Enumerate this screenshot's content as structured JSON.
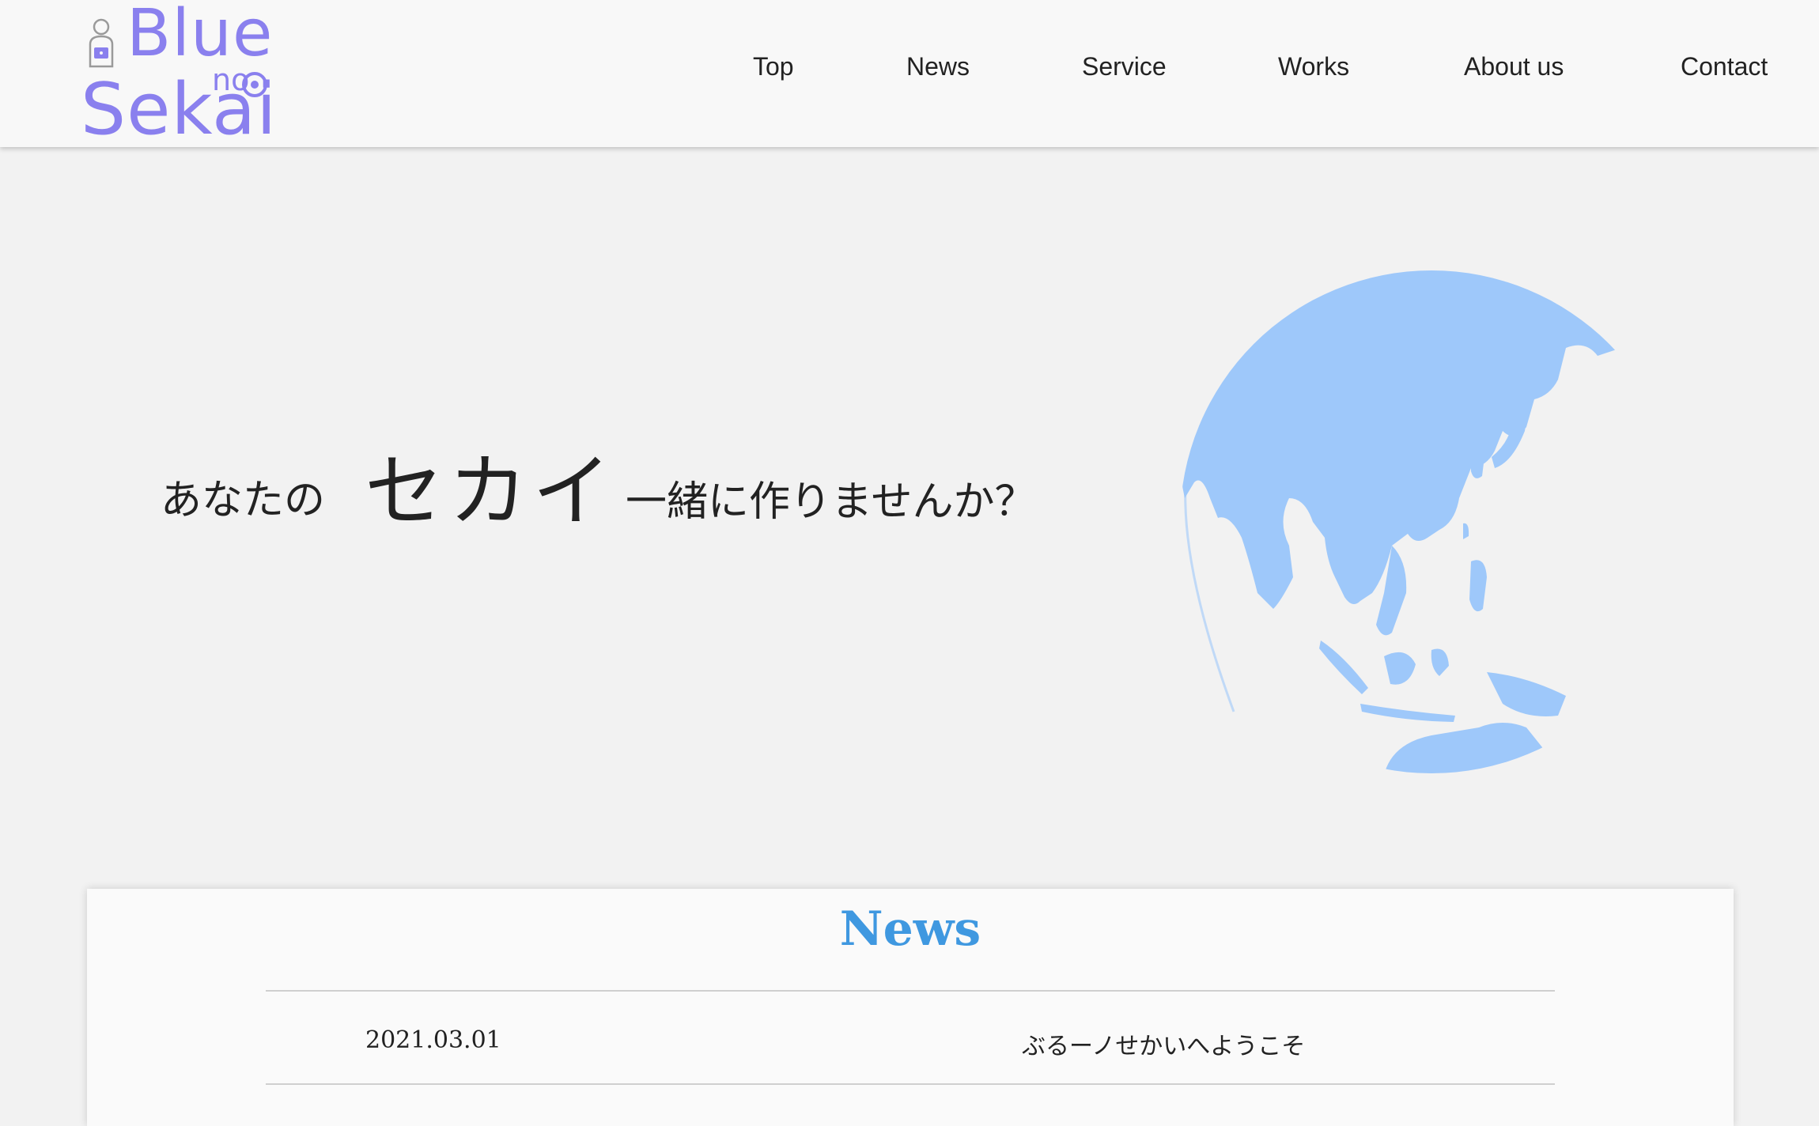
{
  "logo": {
    "line1": "Blue",
    "line2": "no",
    "line3": "Sekai"
  },
  "nav": [
    {
      "label": "Top"
    },
    {
      "label": "News"
    },
    {
      "label": "Service"
    },
    {
      "label": "Works"
    },
    {
      "label": "About us"
    },
    {
      "label": "Contact"
    }
  ],
  "hero": {
    "pre": "あなたの",
    "highlight": "セカイ",
    "post": "一緒に作りませんか？"
  },
  "news": {
    "title": "News",
    "items": [
      {
        "date": "2021.03.01",
        "text": "ぶるーノせかいへようこそ"
      }
    ]
  },
  "colors": {
    "logo": "#8a80ee",
    "accent": "#3f98e0",
    "globe": "#9ec8fa",
    "background": "#f2f2f2"
  },
  "icons": {
    "logo_person": "person-at-laptop-icon",
    "logo_target": "target-icon",
    "globe": "globe-asia-icon"
  }
}
